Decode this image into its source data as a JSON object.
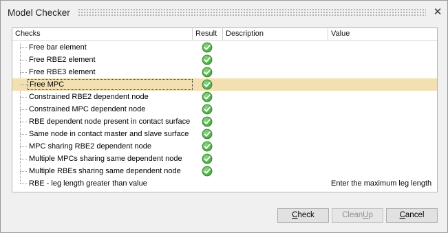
{
  "dialog": {
    "title": "Model Checker",
    "close_glyph": "✕"
  },
  "columns": [
    "Checks",
    "Result",
    "Description",
    "Value"
  ],
  "checks": [
    {
      "label": "Free bar element",
      "result": "ok",
      "value": "",
      "selected": false
    },
    {
      "label": "Free RBE2 element",
      "result": "ok",
      "value": "",
      "selected": false
    },
    {
      "label": "Free RBE3 element",
      "result": "ok",
      "value": "",
      "selected": false
    },
    {
      "label": "Free MPC",
      "result": "ok",
      "value": "",
      "selected": true
    },
    {
      "label": "Constrained RBE2 dependent node",
      "result": "ok",
      "value": "",
      "selected": false
    },
    {
      "label": "Constrained MPC dependent node",
      "result": "ok",
      "value": "",
      "selected": false
    },
    {
      "label": "RBE dependent node present in contact surface",
      "result": "ok",
      "value": "",
      "selected": false
    },
    {
      "label": "Same node in contact master and slave surface",
      "result": "ok",
      "value": "",
      "selected": false
    },
    {
      "label": "MPC sharing RBE2 dependent node",
      "result": "ok",
      "value": "",
      "selected": false
    },
    {
      "label": "Multiple MPCs sharing same dependent node",
      "result": "ok",
      "value": "",
      "selected": false
    },
    {
      "label": "Multiple RBEs sharing same dependent node",
      "result": "ok",
      "value": "",
      "selected": false
    },
    {
      "label": "RBE - leg length greater than value",
      "result": "",
      "value": "Enter the maximum leg length",
      "selected": false
    }
  ],
  "buttons": {
    "check": {
      "pre": "",
      "mnemonic": "C",
      "post": "heck"
    },
    "cleanup": {
      "pre": "Clean",
      "mnemonic": "U",
      "post": "p"
    },
    "cancel": {
      "pre": "",
      "mnemonic": "C",
      "post": "ancel"
    }
  },
  "colors": {
    "selected_row": "#f3e0b2",
    "ok_icon_green": "#3fa535"
  },
  "icons": {
    "ok": "green-check-circle-icon",
    "close": "close-icon"
  }
}
